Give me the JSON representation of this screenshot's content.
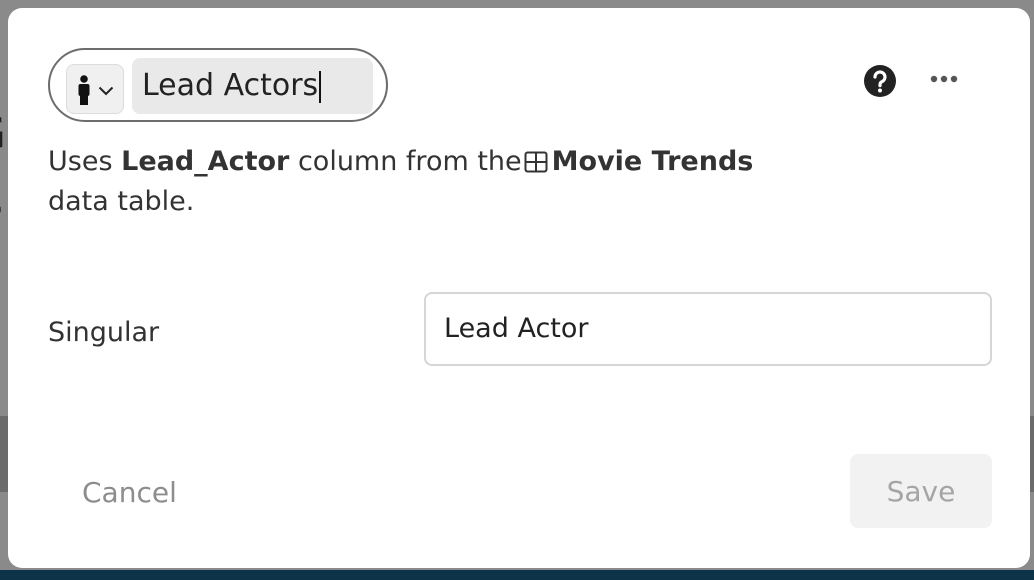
{
  "modal": {
    "name_value": "Lead Actors",
    "icon_name": "person-icon",
    "help_icon": "help-circle-icon",
    "more_icon": "more-horizontal-icon",
    "description": {
      "prefix": "Uses",
      "column": "Lead_Actor",
      "middle": "column from the",
      "table_icon": "table-icon",
      "table_name": "Movie Trends",
      "suffix": "data table."
    },
    "singular_label": "Singular",
    "singular_value": "Lead Actor",
    "cancel_label": "Cancel",
    "save_label": "Save"
  },
  "colors": {
    "backdrop": "#8a8a8a",
    "backdrop_bottom": "#0d3349",
    "modal_bg": "#ffffff",
    "muted_text": "#8d8d8d",
    "disabled_button_bg": "#f2f2f2"
  }
}
